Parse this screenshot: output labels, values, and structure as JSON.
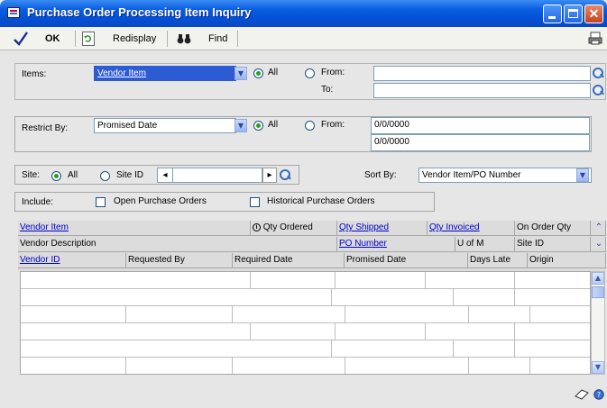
{
  "window": {
    "title": "Purchase Order Processing Item Inquiry"
  },
  "toolbar": {
    "ok_label": "OK",
    "redisplay_label": "Redisplay",
    "find_label": "Find"
  },
  "items": {
    "label": "Items:",
    "selected": "Vendor Item",
    "all_label": "All",
    "from_label": "From:",
    "to_label": "To:",
    "from_value": "",
    "to_value": ""
  },
  "restrict": {
    "label": "Restrict By:",
    "selected": "Promised Date",
    "all_label": "All",
    "from_label": "From:",
    "from_value": "0/0/0000",
    "to_value": "0/0/0000"
  },
  "site": {
    "label": "Site:",
    "all_label": "All",
    "siteid_label": "Site ID",
    "value": ""
  },
  "sort": {
    "label": "Sort By:",
    "selected": "Vendor Item/PO Number"
  },
  "include": {
    "label": "Include:",
    "open_label": "Open Purchase Orders",
    "historical_label": "Historical Purchase Orders",
    "open_checked": false,
    "historical_checked": false
  },
  "grid": {
    "row1": {
      "vendor_item": "Vendor Item",
      "info_icon": "i",
      "qty_ordered": "Qty Ordered",
      "qty_shipped": "Qty Shipped",
      "qty_invoiced": "Qty Invoiced",
      "on_order_qty": "On Order Qty"
    },
    "row2": {
      "vendor_description": "Vendor Description",
      "po_number": "PO Number",
      "u_of_m": "U of M",
      "site_id": "Site ID"
    },
    "row3": {
      "vendor_id": "Vendor ID",
      "requested_by": "Requested By",
      "required_date": "Required Date",
      "promised_date": "Promised Date",
      "days_late": "Days Late",
      "origin": "Origin"
    }
  },
  "icons": {
    "ok": "checkmark-icon",
    "redisplay": "refresh-icon",
    "find": "binoculars-icon",
    "print": "printer-icon",
    "lookup": "magnifier-icon",
    "note": "note-icon",
    "help": "help-icon"
  }
}
